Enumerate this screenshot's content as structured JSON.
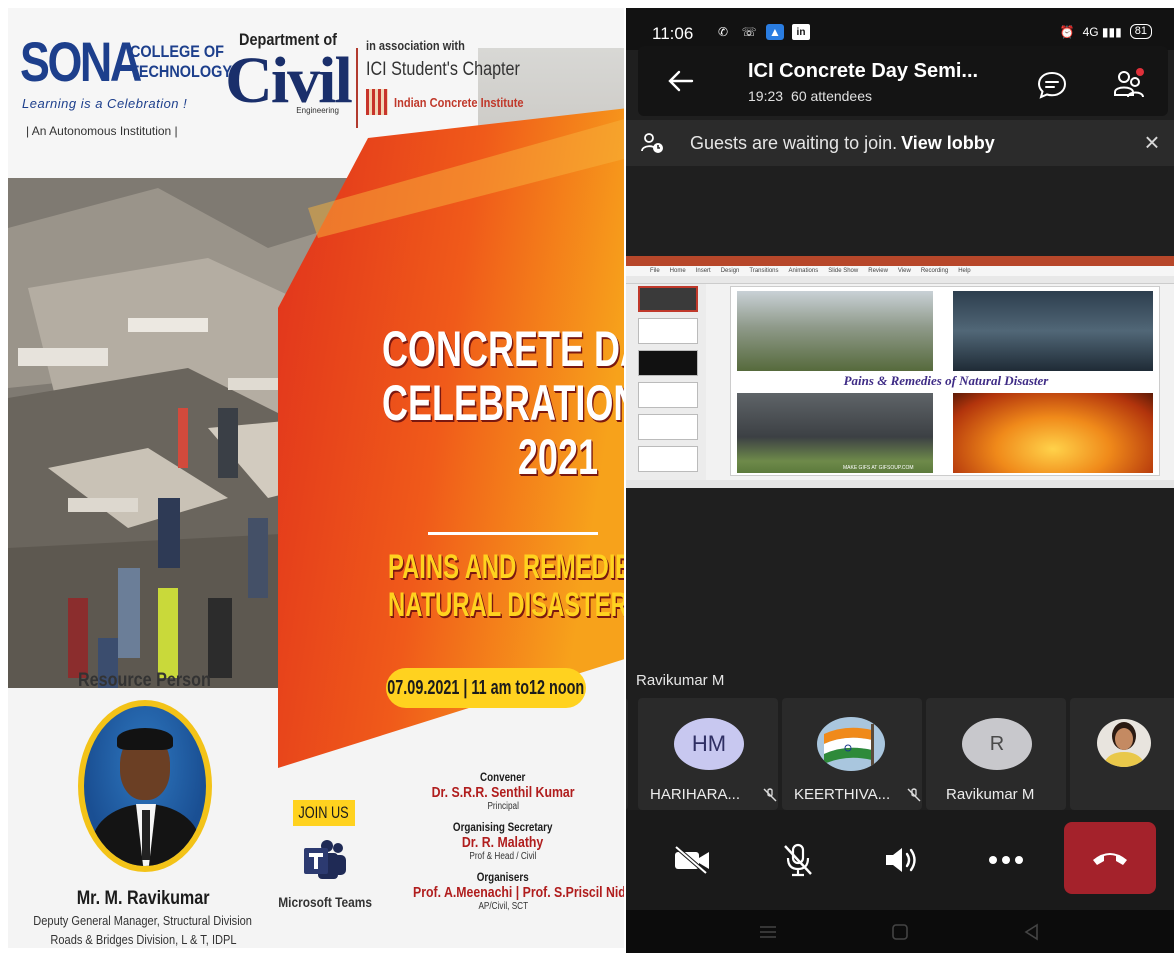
{
  "poster": {
    "college_word": "SONA",
    "college_line1": "COLLEGE OF",
    "college_line2": "TECHNOLOGY",
    "tagline": "Learning is a Celebration !",
    "autonomous": "| An Autonomous Institution |",
    "dept_label": "Department of",
    "dept_name": "Civil",
    "dept_sub": "Engineering",
    "assoc_label": "in association with",
    "ici_chapter": "ICI Student's Chapter",
    "ici_name": "Indian Concrete Institute",
    "headline": [
      "CONCRETE DAY",
      "CELEBRATIONS",
      "2021"
    ],
    "theme": [
      "PAINS AND REMEDIES OF",
      "NATURAL DISASTERS"
    ],
    "date_time": "07.09.2021 | 11 am to12 noon",
    "resource_label": "Resource Person",
    "resource_name": "Mr. M. Ravikumar",
    "resource_role": "Deputy General Manager, Structural Division",
    "resource_org": "Roads & Bridges Division, L & T, IDPL",
    "join_label": "JOIN US",
    "teams_label": "Microsoft Teams",
    "organisers": [
      {
        "role": "Convener",
        "name": "Dr. S.R.R. Senthil Kumar",
        "sub": "Principal"
      },
      {
        "role": "Organising Secretary",
        "name": "Dr. R. Malathy",
        "sub": "Prof & Head / Civil"
      },
      {
        "role": "Organisers",
        "name": "Prof. A.Meenachi | Prof. S.Priscil Nidhu",
        "sub": "AP/Civil, SCT"
      }
    ]
  },
  "phone": {
    "status": {
      "time": "11:06",
      "battery": "81",
      "network": "4G"
    },
    "header": {
      "title": "ICI Concrete Day Semi...",
      "duration": "19:23",
      "attendees": "60 attendees"
    },
    "lobby": {
      "text": "Guests are waiting to join.",
      "link": "View lobby"
    },
    "slide": {
      "caption": "Pains & Remedies of Natural Disaster",
      "ppt_tabs": [
        "File",
        "Home",
        "Insert",
        "Design",
        "Transitions",
        "Animations",
        "Slide Show",
        "Review",
        "View",
        "Recording",
        "Help"
      ],
      "watermark": "MAKE GIFS AT GIFSOUP.COM"
    },
    "presenter": "Ravikumar M",
    "participants": [
      {
        "initials": "HM",
        "name": "HARIHARA...",
        "muted": true
      },
      {
        "initials": "",
        "name": "KEERTHIVA...",
        "muted": true
      },
      {
        "initials": "R",
        "name": "Ravikumar M",
        "muted": false
      },
      {
        "initials": "",
        "name": "",
        "muted": false
      }
    ],
    "colors": {
      "end_call": "#a4222b",
      "accent_avatar": "#c8c8f0",
      "bg": "#1f1f1f"
    }
  }
}
